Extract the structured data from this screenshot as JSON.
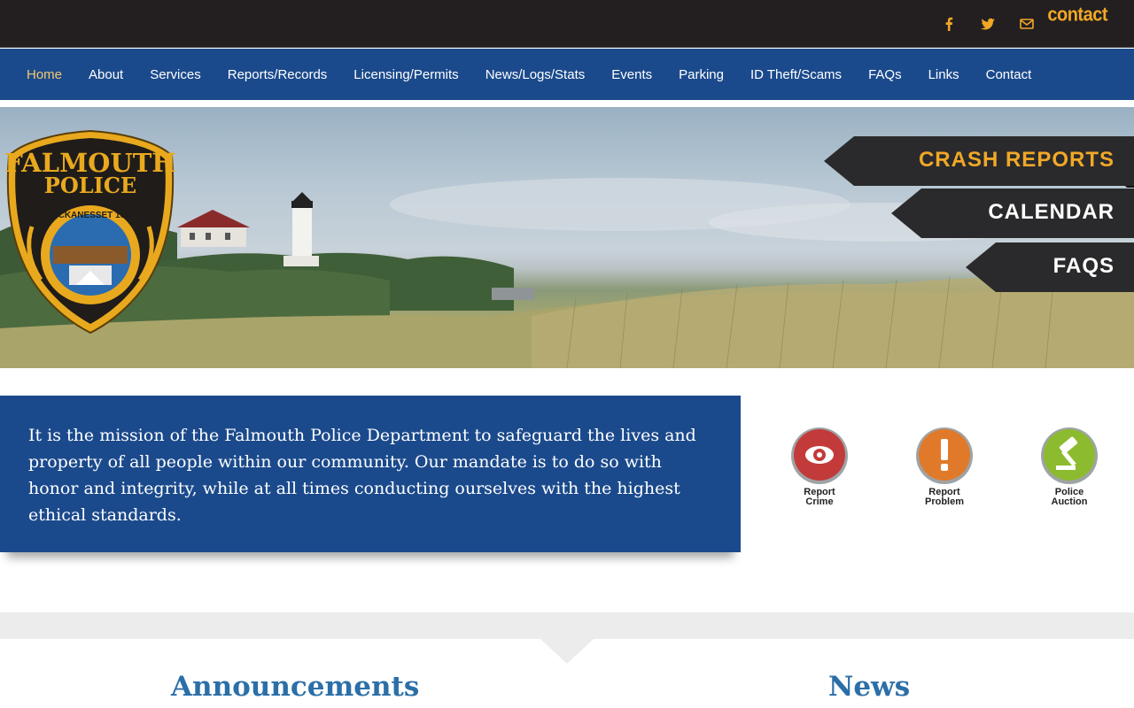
{
  "topbar": {
    "icons": [
      "facebook-icon",
      "twitter-icon",
      "mail-icon"
    ],
    "contact_label": "contact"
  },
  "nav": {
    "items": [
      "Home",
      "About",
      "Services",
      "Reports/Records",
      "Licensing/Permits",
      "News/Logs/Stats",
      "Events",
      "Parking",
      "ID Theft/Scams",
      "FAQs",
      "Links",
      "Contact"
    ],
    "active": "Home"
  },
  "badge": {
    "line1": "FALMOUTH",
    "line2": "POLICE",
    "ribbon": "SUCKANESSET 1602"
  },
  "hero_buttons": {
    "crash_reports": "CRASH REPORTS",
    "calendar": "CALENDAR",
    "faqs": "FAQS"
  },
  "mission": {
    "text": "It is the mission of the Falmouth Police Department to safeguard the lives and property of all people within our community. Our mandate is to do so with honor and integrity, while at all times conducting ourselves with the highest ethical standards."
  },
  "quick_links": {
    "report_crime": [
      "Report",
      "Crime"
    ],
    "report_problem": [
      "Report",
      "Problem"
    ],
    "police_auction": [
      "Police",
      "Auction"
    ]
  },
  "sections": {
    "announcements": "Announcements",
    "news": "News"
  },
  "colors": {
    "topbar": "#231f20",
    "nav": "#1b4a8c",
    "accent": "#f0a826",
    "active_nav": "#f6c86c",
    "heading": "#2b6fa8"
  }
}
